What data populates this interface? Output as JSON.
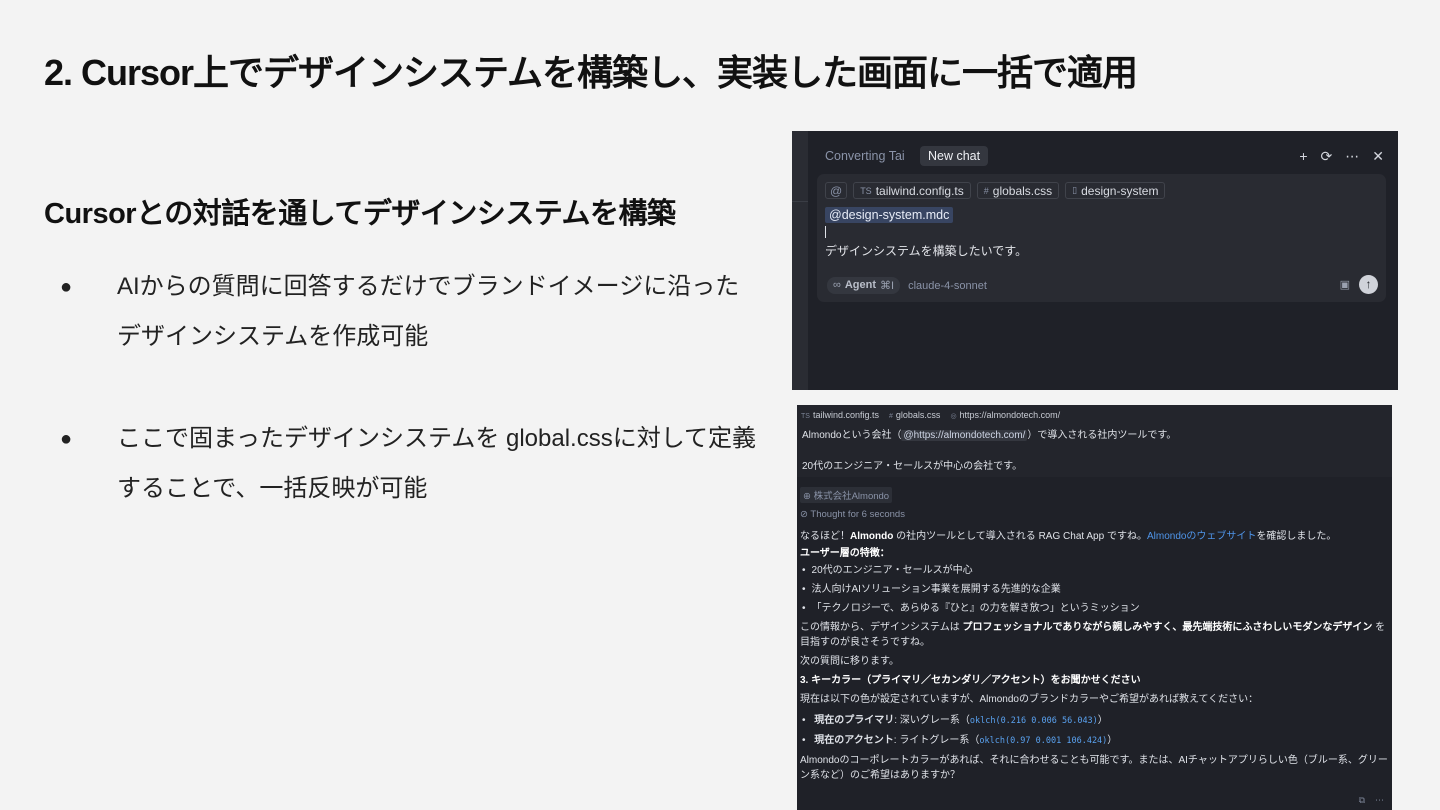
{
  "slide": {
    "title": "2. Cursor上でデザインシステムを構築し、実装した画面に一括で適用",
    "subtitle": "Cursorとの対話を通してデザインシステムを構築",
    "bullets": [
      {
        "marker": "●",
        "text": "AIからの質問に回答するだけでブランドイメージに沿ったデザインシステムを作成可能"
      },
      {
        "marker": "●",
        "text": "ここで固まったデザインシステムを global.cssに対して定義することで、一括反映が可能"
      }
    ]
  },
  "chat_input": {
    "tab_inactive": "Converting Tai",
    "tab_active": "New chat",
    "header_icons": {
      "add": "+",
      "history": "⟳",
      "more": "⋯",
      "close": "✕"
    },
    "at_symbol": "@",
    "chips": [
      {
        "icon": "TS",
        "label": "tailwind.config.ts"
      },
      {
        "icon": "#",
        "label": "globals.css"
      },
      {
        "icon": "▯",
        "label": "design-system"
      }
    ],
    "mention": "@design-system.mdc",
    "prompt": "デザインシステムを構築したいです。",
    "agent_icon": "∞",
    "agent_label": "Agent",
    "agent_shortcut": "⌘I",
    "model": "claude-4-sonnet",
    "image_icon": "▣",
    "send_icon": "↑"
  },
  "chat_log": {
    "chips": [
      {
        "icon": "TS",
        "label": "tailwind.config.ts"
      },
      {
        "icon": "#",
        "label": "globals.css"
      },
      {
        "icon": "◎",
        "label": "https://almondotech.com/"
      }
    ],
    "user_line1_pre": "Almondoという会社（",
    "user_line1_link": "@https://almondotech.com/",
    "user_line1_post": "）で導入される社内ツールです。",
    "user_line2": "20代のエンジニア・セールスが中心の会社です。",
    "company_chip": "⊕ 株式会社Almondo",
    "thought": "⊘ Thought for 6 seconds",
    "reply_intro_1": "なるほど！",
    "reply_intro_bold": "Almondo",
    "reply_intro_2": " の社内ツールとして導入される RAG Chat App ですね。",
    "reply_intro_link": "Almondoのウェブサイト",
    "reply_intro_3": "を確認しました。",
    "users_heading": "ユーザー層の特徴：",
    "user_traits": [
      "20代のエンジニア・セールスが中心",
      "法人向けAIソリューション事業を展開する先進的な企業",
      "「テクノロジーで、あらゆる『ひと』の力を解き放つ」というミッション"
    ],
    "design_1": "この情報から、デザインシステムは ",
    "design_bold": "プロフェッショナルでありながら親しみやすく、最先端技術にふさわしいモダンなデザイン",
    "design_2": " を目指すのが良さそうですね。",
    "next": "次の質問に移ります。",
    "question_heading": "3. キーカラー（プライマリ／セカンダリ／アクセント）をお聞かせください",
    "current_intro": "現在は以下の色が設定されていますが、Almondoのブランドカラーやご希望があれば教えてください：",
    "colors": [
      {
        "label": "現在のプライマリ",
        "desc": ": 深いグレー系（",
        "code": "oklch(0.216 0.006 56.043)",
        "close": "）"
      },
      {
        "label": "現在のアクセント",
        "desc": ": ライトグレー系（",
        "code": "oklch(0.97 0.001 106.424)",
        "close": "）"
      }
    ],
    "closing": "Almondoのコーポレートカラーがあれば、それに合わせることも可能です。または、AIチャットアプリらしい色（ブルー系、グリーン系など）のご希望はありますか？",
    "footer_icons": {
      "copy": "⧉",
      "more": "⋯"
    }
  }
}
